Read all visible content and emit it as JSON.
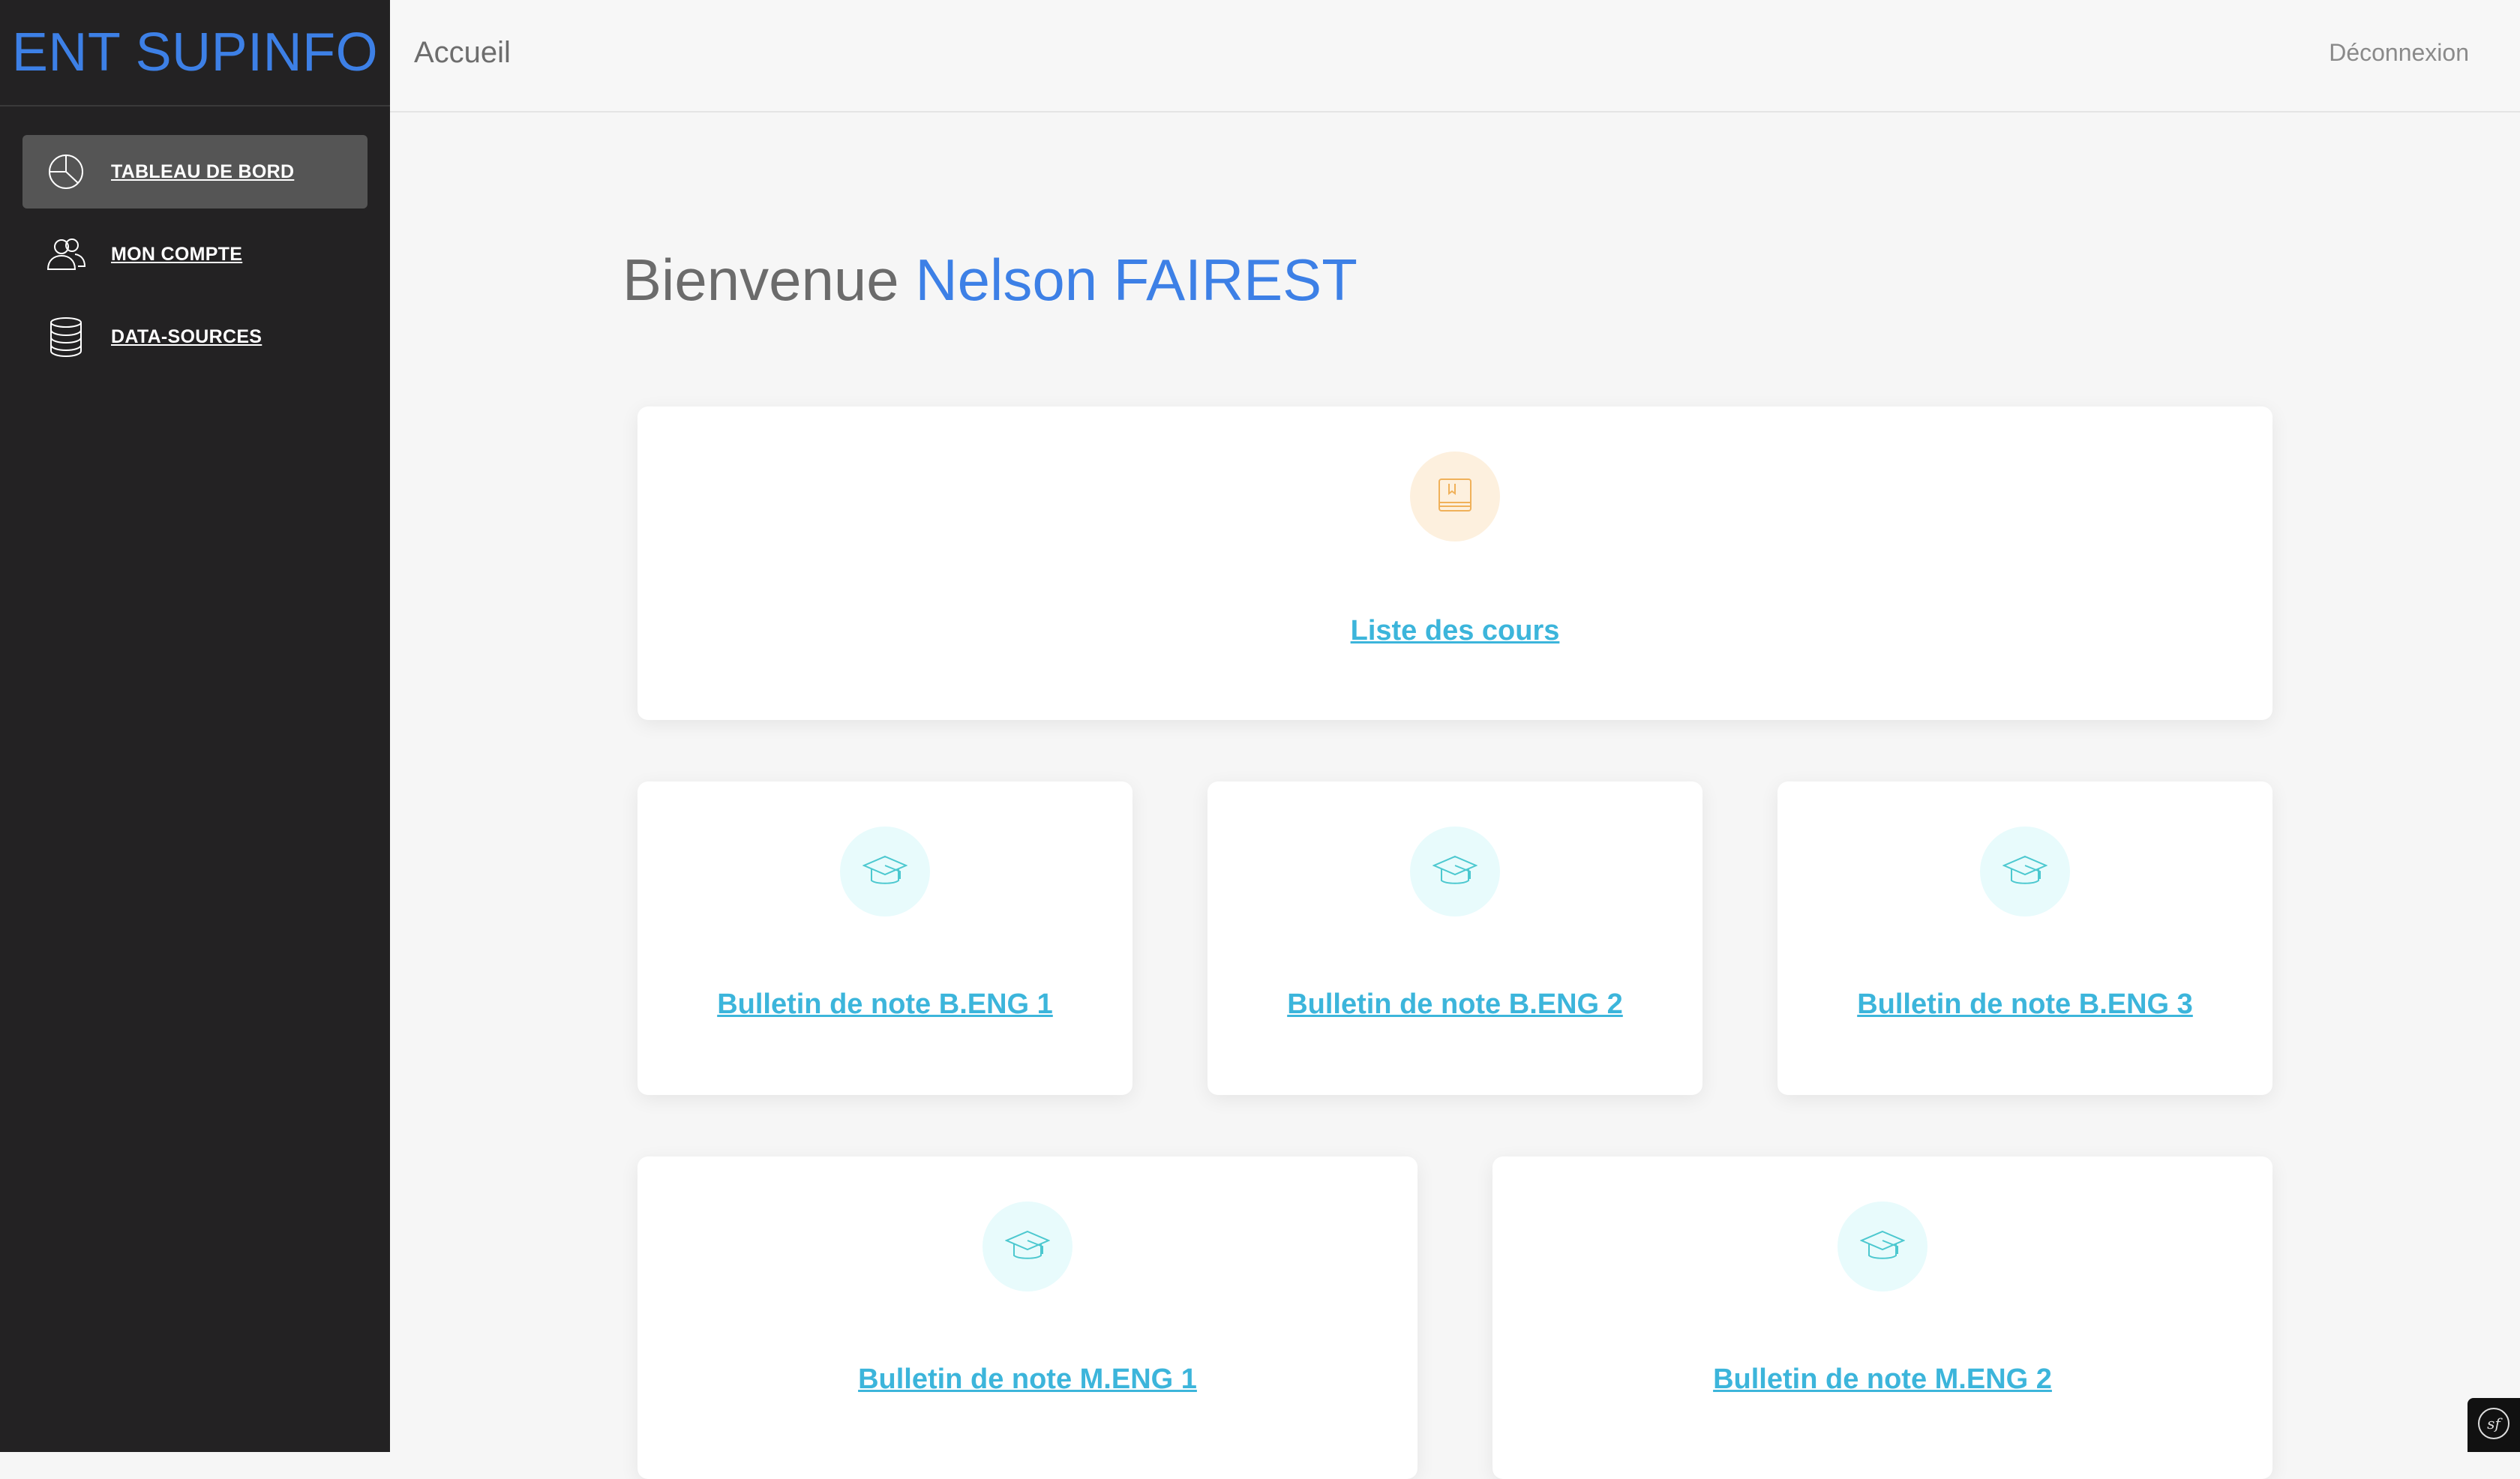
{
  "app": {
    "brand": "ENT SUPINFO"
  },
  "sidebar": {
    "items": [
      {
        "label": "TABLEAU DE BORD",
        "icon": "pie-chart-icon",
        "active": true
      },
      {
        "label": "MON COMPTE",
        "icon": "users-icon",
        "active": false
      },
      {
        "label": "DATA-SOURCES",
        "icon": "database-icon",
        "active": false
      }
    ]
  },
  "header": {
    "breadcrumb": "Accueil",
    "logout_label": "Déconnexion"
  },
  "main": {
    "welcome_prefix": "Bienvenue",
    "user_name": "Nelson FAIREST",
    "cards": [
      {
        "label": "Liste des cours",
        "icon": "book-icon",
        "color": "#f0b15a"
      },
      {
        "label": "Bulletin de note B.ENG 1",
        "icon": "graduation-cap-icon",
        "color": "#4cc8cf"
      },
      {
        "label": "Bulletin de note B.ENG 2",
        "icon": "graduation-cap-icon",
        "color": "#4cc8cf"
      },
      {
        "label": "Bulletin de note B.ENG 3",
        "icon": "graduation-cap-icon",
        "color": "#4cc8cf"
      },
      {
        "label": "Bulletin de note M.ENG 1",
        "icon": "graduation-cap-icon",
        "color": "#4cc8cf"
      },
      {
        "label": "Bulletin de note M.ENG 2",
        "icon": "graduation-cap-icon",
        "color": "#4cc8cf"
      }
    ]
  },
  "colors": {
    "brand": "#3d80e6",
    "link": "#3cb5db",
    "sidebar_bg": "#232223"
  }
}
